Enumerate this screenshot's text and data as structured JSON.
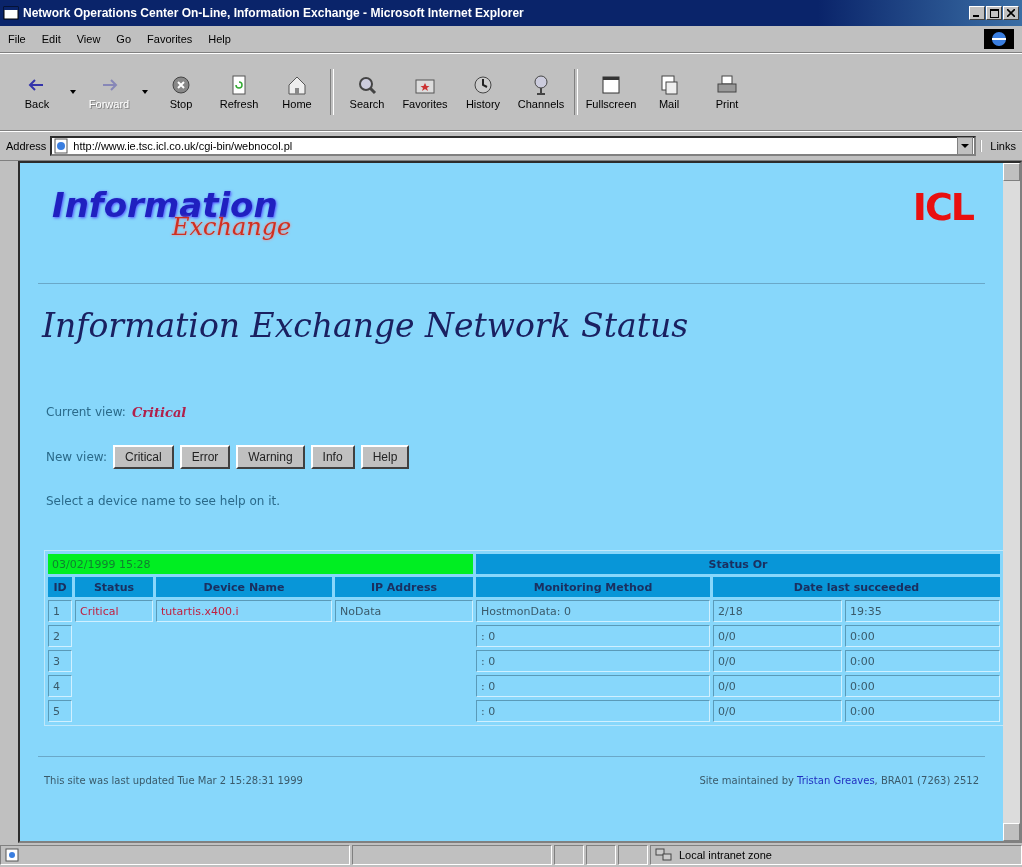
{
  "window": {
    "title": "Network Operations Center On-Line, Information Exchange - Microsoft Internet Explorer"
  },
  "menu": [
    "File",
    "Edit",
    "View",
    "Go",
    "Favorites",
    "Help"
  ],
  "toolbar": [
    {
      "label": "Back",
      "kind": "back",
      "disabled": false,
      "dropdown": true
    },
    {
      "label": "Forward",
      "kind": "forward",
      "disabled": true,
      "dropdown": true
    },
    {
      "label": "Stop",
      "kind": "stop",
      "disabled": false,
      "dropdown": false
    },
    {
      "label": "Refresh",
      "kind": "refresh",
      "disabled": false,
      "dropdown": false
    },
    {
      "label": "Home",
      "kind": "home",
      "disabled": false,
      "dropdown": false
    },
    {
      "label": "Search",
      "kind": "search",
      "disabled": false,
      "dropdown": false
    },
    {
      "label": "Favorites",
      "kind": "favorites",
      "disabled": false,
      "dropdown": false
    },
    {
      "label": "History",
      "kind": "history",
      "disabled": false,
      "dropdown": false
    },
    {
      "label": "Channels",
      "kind": "channels",
      "disabled": false,
      "dropdown": false
    },
    {
      "label": "Fullscreen",
      "kind": "fullscreen",
      "disabled": false,
      "dropdown": false
    },
    {
      "label": "Mail",
      "kind": "mail",
      "disabled": false,
      "dropdown": false
    },
    {
      "label": "Print",
      "kind": "print",
      "disabled": false,
      "dropdown": false
    }
  ],
  "address": {
    "label": "Address",
    "value": "http://www.ie.tsc.icl.co.uk/cgi-bin/webnocol.pl",
    "links": "Links"
  },
  "page": {
    "logo_main": "Information",
    "logo_sub": "Exchange",
    "brand": "ICL",
    "heading": "Information Exchange Network Status",
    "current_view_label": "Current view:",
    "current_view": "Critical",
    "new_view_label": "New view:",
    "view_buttons": [
      "Critical",
      "Error",
      "Warning",
      "Info",
      "Help"
    ],
    "hint": "Select a device name to see help on it.",
    "table": {
      "timestamp": "03/02/1999 15:28",
      "group_heading": "Status Or",
      "columns": [
        "ID",
        "Status",
        "Device Name",
        "IP Address",
        "Monitoring Method",
        "Date last succeeded"
      ],
      "rows": [
        {
          "id": "1",
          "status": "Critical",
          "device": "tutartis.x400.i",
          "ip": "NoData",
          "method": "HostmonData: 0",
          "date": "2/18",
          "time": "19:35"
        },
        {
          "id": "2",
          "method": ": 0",
          "date": "0/0",
          "time": "0:00"
        },
        {
          "id": "3",
          "method": ": 0",
          "date": "0/0",
          "time": "0:00"
        },
        {
          "id": "4",
          "method": ": 0",
          "date": "0/0",
          "time": "0:00"
        },
        {
          "id": "5",
          "method": ": 0",
          "date": "0/0",
          "time": "0:00"
        }
      ]
    },
    "footer_left": "This site was last updated Tue Mar 2 15:28:31 1999",
    "footer_right_prefix": "Site maintained by",
    "footer_link": "Tristan Greaves",
    "footer_right_suffix": ", BRA01 (7263) 2512"
  },
  "status_bar": {
    "zone": "Local intranet zone"
  }
}
